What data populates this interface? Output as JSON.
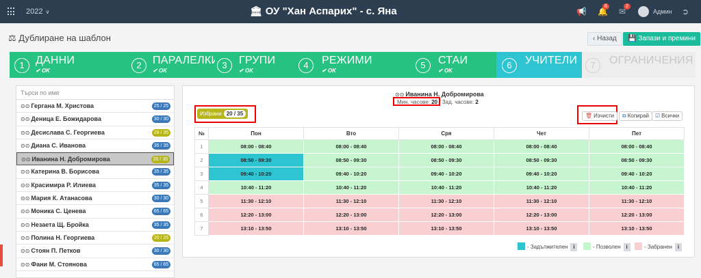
{
  "topbar": {
    "year": "2022",
    "title": "ОУ \"Хан Аспарих\" - с. Яна",
    "notifications_count": "6",
    "messages_count": "2",
    "user": "Админ"
  },
  "page": {
    "title": "Дублиране на шаблон",
    "back_label": "Назад",
    "save_label": "Запази и премини"
  },
  "steps": [
    {
      "num": "1",
      "label": "ДАННИ",
      "status": "OK"
    },
    {
      "num": "2",
      "label": "ПАРАЛЕЛКИ",
      "status": "OK"
    },
    {
      "num": "3",
      "label": "ГРУПИ",
      "status": "OK"
    },
    {
      "num": "4",
      "label": "РЕЖИМИ",
      "status": "OK"
    },
    {
      "num": "5",
      "label": "СТАИ",
      "status": "OK"
    },
    {
      "num": "6",
      "label": "УЧИТЕЛИ",
      "status": ""
    },
    {
      "num": "7",
      "label": "ОГРАНИЧЕНИЯ",
      "status": ""
    }
  ],
  "teacher_list": {
    "search_placeholder": "Търси по име",
    "teachers": [
      {
        "name": "Гергана М. Христова",
        "hours": "25 / 25",
        "color": "blue"
      },
      {
        "name": "Деница Е. Божидарова",
        "hours": "30 / 30",
        "color": "blue"
      },
      {
        "name": "Десислава С. Георгиева",
        "hours": "28 / 35",
        "color": "olive"
      },
      {
        "name": "Диана С. Иванова",
        "hours": "35 / 35",
        "color": "blue"
      },
      {
        "name": "Иванина Н. Добромирова",
        "hours": "20 / 35",
        "color": "olive",
        "selected": true
      },
      {
        "name": "Катерина В. Борисова",
        "hours": "35 / 35",
        "color": "blue"
      },
      {
        "name": "Красимира Р. Илиева",
        "hours": "35 / 35",
        "color": "blue"
      },
      {
        "name": "Мария К. Атанасова",
        "hours": "30 / 30",
        "color": "blue"
      },
      {
        "name": "Моника С. Ценева",
        "hours": "65 / 65",
        "color": "blue"
      },
      {
        "name": "Незаета Щ. Бройка",
        "hours": "35 / 35",
        "color": "blue"
      },
      {
        "name": "Полина Н. Георгиева",
        "hours": "20 / 25",
        "color": "olive"
      },
      {
        "name": "Стоян П. Петков",
        "hours": "30 / 30",
        "color": "blue"
      },
      {
        "name": "Фани М. Стоянова",
        "hours": "65 / 65",
        "color": "blue"
      }
    ]
  },
  "schedule": {
    "teacher_name": "Иванина Н. Добромирова",
    "min_hours_label": "Мин. часове:",
    "min_hours": "20",
    "set_hours_label": "Зад. часове:",
    "set_hours": "2",
    "selected_label": "Избрани",
    "selected_count": "20 / 35",
    "clear_label": "Изчисти",
    "copy_label": "Копирай",
    "all_label": "Всички",
    "columns": [
      "№",
      "Пон",
      "Вто",
      "Сря",
      "Чет",
      "Пет"
    ],
    "rows": [
      {
        "num": "1",
        "time": "08:00 - 08:40",
        "cells": [
          "allowed",
          "allowed",
          "allowed",
          "allowed",
          "allowed"
        ]
      },
      {
        "num": "2",
        "time": "08:50 - 09:30",
        "cells": [
          "mandatory",
          "allowed",
          "allowed",
          "allowed",
          "allowed"
        ]
      },
      {
        "num": "3",
        "time": "09:40 - 10:20",
        "cells": [
          "mandatory",
          "allowed",
          "allowed",
          "allowed",
          "allowed"
        ]
      },
      {
        "num": "4",
        "time": "10:40 - 11:20",
        "cells": [
          "allowed",
          "allowed",
          "allowed",
          "allowed",
          "allowed"
        ]
      },
      {
        "num": "5",
        "time": "11:30 - 12:10",
        "cells": [
          "forbidden",
          "forbidden",
          "forbidden",
          "forbidden",
          "forbidden"
        ]
      },
      {
        "num": "6",
        "time": "12:20 - 13:00",
        "cells": [
          "forbidden",
          "forbidden",
          "forbidden",
          "forbidden",
          "forbidden"
        ]
      },
      {
        "num": "7",
        "time": "13:10 - 13:50",
        "cells": [
          "forbidden",
          "forbidden",
          "forbidden",
          "forbidden",
          "forbidden"
        ]
      }
    ],
    "legend": {
      "mandatory": "- Задължителен",
      "allowed": "- Позволен",
      "forbidden": "- Забранен"
    }
  },
  "colors": {
    "topbar": "#2d3e50",
    "step_done": "#26c281",
    "step_active": "#2fc4d1",
    "mandatory": "#2fc4d1",
    "allowed": "#c6f5cf",
    "forbidden": "#f9cfd2",
    "pill_blue": "#3b78b8",
    "pill_olive": "#b7b51a"
  }
}
